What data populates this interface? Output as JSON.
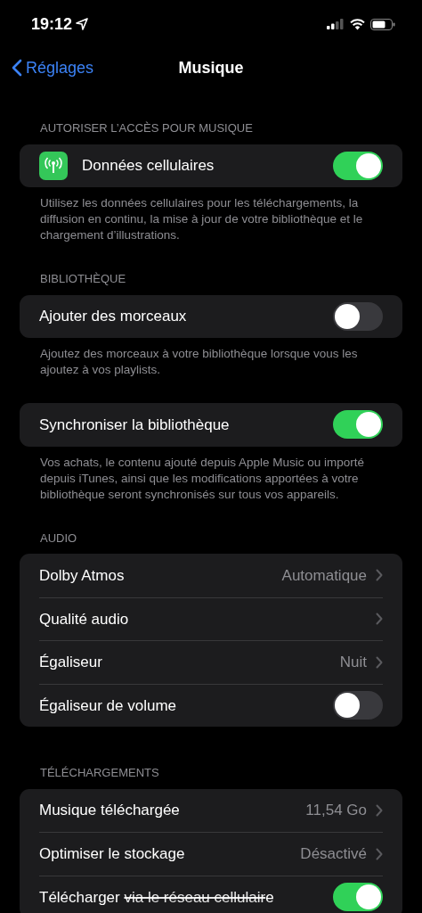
{
  "status_bar": {
    "time": "19:12"
  },
  "nav": {
    "back": "Réglages",
    "title": "Musique"
  },
  "sections": [
    {
      "header": "AUTORISER L’ACCÈS POUR MUSIQUE",
      "rows": [
        {
          "kind": "icon_toggle",
          "label": "Données cellulaires",
          "on": true
        }
      ],
      "footer": "Utilisez les données cellulaires pour les téléchargements, la diffusion en continu, la mise à jour de votre bibliothèque et le chargement d’illustrations."
    },
    {
      "header": "BIBLIOTHÈQUE",
      "rows": [
        {
          "kind": "toggle",
          "label": "Ajouter des morceaux",
          "on": false
        }
      ],
      "footer": "Ajoutez des morceaux à votre bibliothèque lorsque vous les ajoutez à vos playlists."
    },
    {
      "rows": [
        {
          "kind": "toggle",
          "label": "Synchroniser la bibliothèque",
          "on": true
        }
      ],
      "footer": "Vos achats, le contenu ajouté depuis Apple Music ou importé depuis iTunes, ainsi que les modifications apportées à votre bibliothèque seront synchronisés sur tous vos appareils."
    },
    {
      "header": "AUDIO",
      "rows": [
        {
          "kind": "link",
          "label": "Dolby Atmos",
          "value": "Automatique"
        },
        {
          "kind": "link",
          "label": "Qualité audio"
        },
        {
          "kind": "link",
          "label": "Égaliseur",
          "value": "Nuit"
        },
        {
          "kind": "toggle",
          "label": "Égaliseur de volume",
          "on": false
        }
      ]
    },
    {
      "header": "TÉLÉCHARGEMENTS",
      "rows": [
        {
          "kind": "link",
          "label": "Musique téléchargée",
          "value": "11,54 Go"
        },
        {
          "kind": "link",
          "label": "Optimiser le stockage",
          "value": "Désactivé"
        },
        {
          "kind": "toggle",
          "label": "Télécharger ",
          "struck": "via le réseau cellulair",
          "label_end": "e",
          "on": true
        }
      ]
    }
  ]
}
